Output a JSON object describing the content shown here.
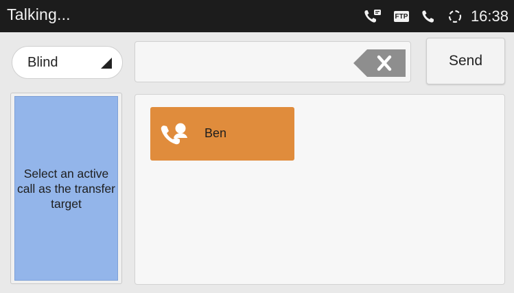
{
  "status_bar": {
    "title": "Talking...",
    "ftp_badge": "FTP",
    "time": "16:38",
    "icons": [
      "voicemail-call-icon",
      "ftp-icon",
      "phone-icon",
      "sync-icon"
    ]
  },
  "transfer": {
    "mode": "Blind",
    "number_value": "",
    "send_label": "Send",
    "target_hint": "Select an active call as the transfer target"
  },
  "calls": [
    {
      "name": "Ben",
      "icon": "active-call-contact-icon"
    }
  ],
  "colors": {
    "status_bar_bg": "#1c1c1c",
    "call_card_bg": "#e08c3c",
    "target_bg": "#93b5ea",
    "page_bg": "#e9e9e9"
  }
}
